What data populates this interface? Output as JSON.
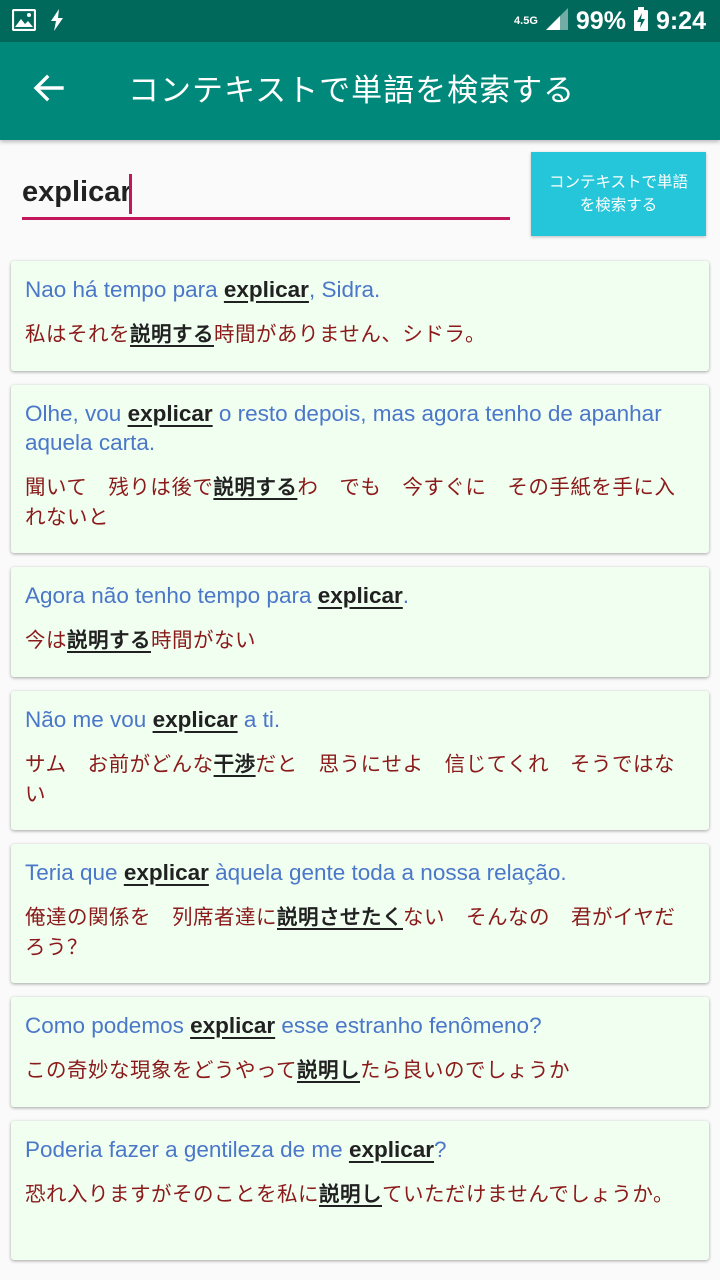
{
  "status_bar": {
    "network": "4.5G",
    "battery": "99%",
    "time": "9:24",
    "icons": [
      "image-icon",
      "flash-icon",
      "signal-icon",
      "battery-icon"
    ]
  },
  "app_bar": {
    "title": "コンテキストで単語を検索する"
  },
  "search": {
    "value": "explicar",
    "button_label": "コンテキストで単語\nを検索する"
  },
  "colors": {
    "status_bar": "#00695c",
    "app_bar": "#00897b",
    "accent": "#c2185b",
    "button": "#26c6da",
    "card_bg": "#f1fff1",
    "source_text": "#4b77c9",
    "target_text": "#8b1a1a"
  },
  "results": [
    {
      "pt": [
        {
          "t": "Nao há tempo para "
        },
        {
          "t": "explicar",
          "hl": true
        },
        {
          "t": ", Sidra."
        }
      ],
      "ja": [
        {
          "t": "私はそれを"
        },
        {
          "t": "説明する",
          "hl": true
        },
        {
          "t": "時間がありません、シドラ。"
        }
      ]
    },
    {
      "pt": [
        {
          "t": "Olhe, vou "
        },
        {
          "t": "explicar",
          "hl": true
        },
        {
          "t": " o resto depois, mas agora tenho de apanhar aquela carta."
        }
      ],
      "ja": [
        {
          "t": "聞いて　残りは後で"
        },
        {
          "t": "説明する",
          "hl": true
        },
        {
          "t": "わ　でも　今すぐに　その手紙を手に入れないと"
        }
      ]
    },
    {
      "pt": [
        {
          "t": "Agora não tenho tempo para "
        },
        {
          "t": "explicar",
          "hl": true
        },
        {
          "t": "."
        }
      ],
      "ja": [
        {
          "t": "今は"
        },
        {
          "t": "説明する",
          "hl": true
        },
        {
          "t": "時間がない"
        }
      ]
    },
    {
      "pt": [
        {
          "t": "Não me vou "
        },
        {
          "t": "explicar",
          "hl": true
        },
        {
          "t": " a ti."
        }
      ],
      "ja": [
        {
          "t": "サム　お前がどんな"
        },
        {
          "t": "干渉",
          "hl": true
        },
        {
          "t": "だと　思うにせよ　信じてくれ　そうではない"
        }
      ]
    },
    {
      "pt": [
        {
          "t": "Teria que "
        },
        {
          "t": "explicar",
          "hl": true
        },
        {
          "t": " àquela gente toda a nossa relação."
        }
      ],
      "ja": [
        {
          "t": "俺達の関係を　列席者達に"
        },
        {
          "t": "説明させたく",
          "hl": true
        },
        {
          "t": "ない　そんなの　君がイヤだろう？"
        }
      ]
    },
    {
      "pt": [
        {
          "t": "Como podemos "
        },
        {
          "t": "explicar",
          "hl": true
        },
        {
          "t": " esse estranho fenômeno?"
        }
      ],
      "ja": [
        {
          "t": "この奇妙な現象をどうやって"
        },
        {
          "t": "説明し",
          "hl": true
        },
        {
          "t": "たら良いのでしょうか"
        }
      ]
    },
    {
      "pt": [
        {
          "t": "Poderia fazer a gentileza de me "
        },
        {
          "t": "explicar",
          "hl": true
        },
        {
          "t": "?"
        }
      ],
      "ja": [
        {
          "t": "恐れ入りますがそのことを私に"
        },
        {
          "t": "説明し",
          "hl": true
        },
        {
          "t": "ていただけませんでしょうか。"
        }
      ]
    }
  ]
}
